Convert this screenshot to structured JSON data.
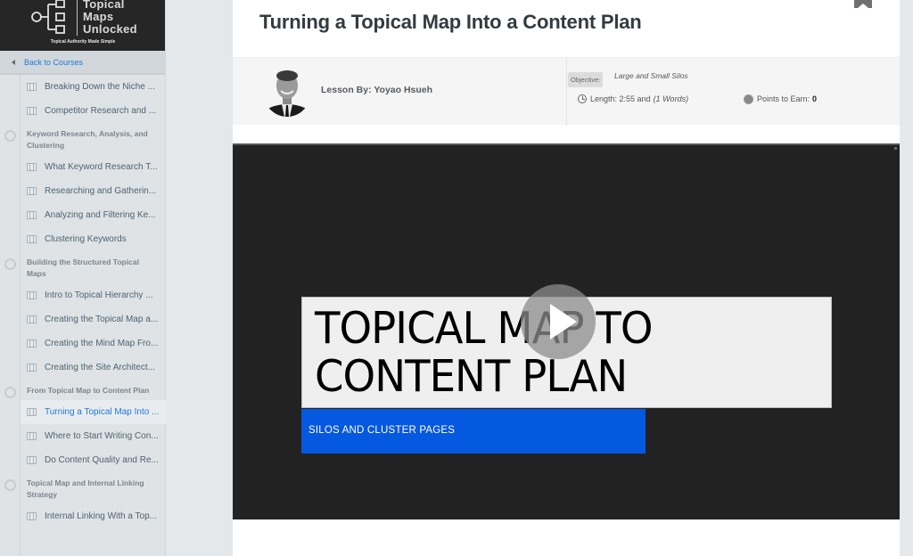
{
  "sidebar": {
    "logo": {
      "line1": "Topical",
      "line2": "Maps",
      "line3": "Unlocked",
      "tagline": "Topical Authority Made Simple"
    },
    "back_link": "Back to Courses",
    "items": [
      {
        "type": "lesson",
        "label": "Breaking Down the Niche ..."
      },
      {
        "type": "lesson",
        "label": "Competitor Research and ..."
      },
      {
        "type": "section",
        "label": "Keyword Research, Analysis, and Clustering"
      },
      {
        "type": "lesson",
        "label": "What Keyword Research T..."
      },
      {
        "type": "lesson",
        "label": "Researching and Gatherin..."
      },
      {
        "type": "lesson",
        "label": "Analyzing and Filtering Ke..."
      },
      {
        "type": "lesson",
        "label": "Clustering Keywords"
      },
      {
        "type": "section",
        "label": "Building the Structured Topical Maps"
      },
      {
        "type": "lesson",
        "label": "Intro to Topical Hierarchy ..."
      },
      {
        "type": "lesson",
        "label": "Creating the Topical Map a..."
      },
      {
        "type": "lesson",
        "label": "Creating the Mind Map Fro..."
      },
      {
        "type": "lesson",
        "label": "Creating the Site Architect..."
      },
      {
        "type": "section",
        "label": "From Topical Map to Content Plan"
      },
      {
        "type": "lesson",
        "label": "Turning a Topical Map Into ...",
        "active": true
      },
      {
        "type": "lesson",
        "label": "Where to Start Writing Con..."
      },
      {
        "type": "lesson",
        "label": "Do Content Quality and Re..."
      },
      {
        "type": "section",
        "label": "Topical Map and Internal Linking Strategy"
      },
      {
        "type": "lesson",
        "label": "Internal Linking With a Top..."
      }
    ]
  },
  "main": {
    "title": "Turning a Topical Map Into a Content Plan",
    "lesson_by": "Lesson By: Yoyao Hsueh",
    "objective_label": "Objective:",
    "objective_value": "Large and Small Silos",
    "length_label": "Length: 2:55 and",
    "length_words": "(1 Words)",
    "points_label": "Points to Earn:",
    "points_value": "0",
    "video": {
      "slide_title_line1": "TOPICAL MAP TO",
      "slide_title_line2": "CONTENT PLAN",
      "slide_subtitle": "SILOS AND CLUSTER PAGES"
    }
  },
  "colors": {
    "accent": "#1f7ad8",
    "slide_blue": "#0558e0",
    "video_bg": "#222222",
    "logo_bg": "#262626"
  }
}
